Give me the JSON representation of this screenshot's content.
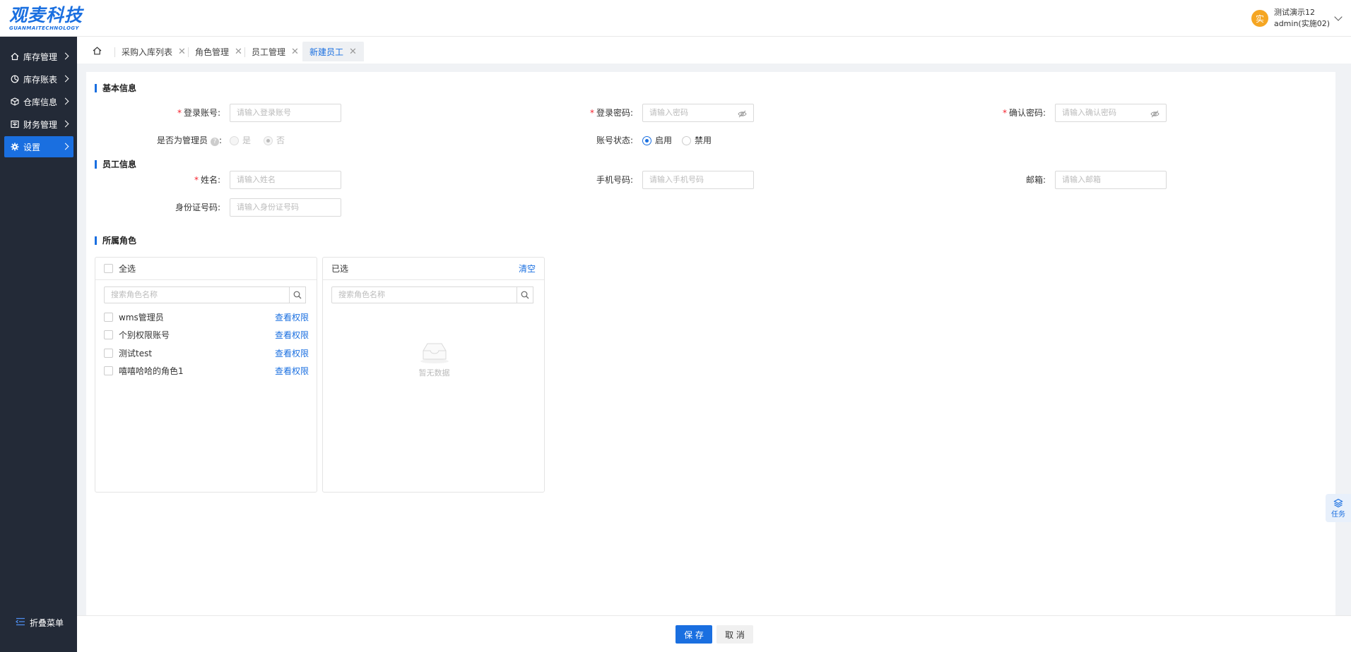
{
  "brand": {
    "name": "观麦科技",
    "sub": "GUANMAITECHNOLOGY",
    "color": "#1a6fe0"
  },
  "user": {
    "avatar": "实",
    "name": "测试演示12",
    "account": "admin(实施02)"
  },
  "sidebar": {
    "items": [
      {
        "label": "库存管理",
        "icon": "home-icon"
      },
      {
        "label": "库存账表",
        "icon": "chart-icon"
      },
      {
        "label": "仓库信息",
        "icon": "box-icon"
      },
      {
        "label": "财务管理",
        "icon": "finance-icon"
      },
      {
        "label": "设置",
        "icon": "gear-icon",
        "active": true
      }
    ],
    "collapse_label": "折叠菜单"
  },
  "tabs": [
    {
      "label": "采购入库列表"
    },
    {
      "label": "角色管理"
    },
    {
      "label": "员工管理"
    },
    {
      "label": "新建员工",
      "active": true
    }
  ],
  "sections": {
    "basic": "基本信息",
    "employee": "员工信息",
    "roles": "所属角色"
  },
  "form": {
    "login_account": {
      "label": "登录账号:",
      "placeholder": "请输入登录账号"
    },
    "login_password": {
      "label": "登录密码:",
      "placeholder": "请输入密码"
    },
    "confirm_password": {
      "label": "确认密码:",
      "placeholder": "请输入确认密码"
    },
    "is_admin": {
      "label": "是否为管理员",
      "suffix": ":",
      "options": [
        "是",
        "否"
      ],
      "selected": "否"
    },
    "account_status": {
      "label": "账号状态:",
      "options": [
        "启用",
        "禁用"
      ],
      "selected": "启用"
    },
    "name": {
      "label": "姓名:",
      "placeholder": "请输入姓名"
    },
    "phone": {
      "label": "手机号码:",
      "placeholder": "请输入手机号码"
    },
    "email": {
      "label": "邮箱:",
      "placeholder": "请输入邮箱"
    },
    "id_card": {
      "label": "身份证号码:",
      "placeholder": "请输入身份证号码"
    }
  },
  "transfer": {
    "left": {
      "select_all": "全选",
      "search_placeholder": "搜索角色名称",
      "items": [
        {
          "name": "wms管理员",
          "link": "查看权限"
        },
        {
          "name": "个别权限账号",
          "link": "查看权限"
        },
        {
          "name": "测试test",
          "link": "查看权限"
        },
        {
          "name": "嘻嘻哈哈的角色1",
          "link": "查看权限"
        }
      ]
    },
    "right": {
      "title": "已选",
      "clear": "清空",
      "search_placeholder": "搜索角色名称",
      "empty": "暂无数据"
    }
  },
  "footer": {
    "save": "保 存",
    "cancel": "取 消"
  },
  "float": {
    "task": "任务"
  }
}
